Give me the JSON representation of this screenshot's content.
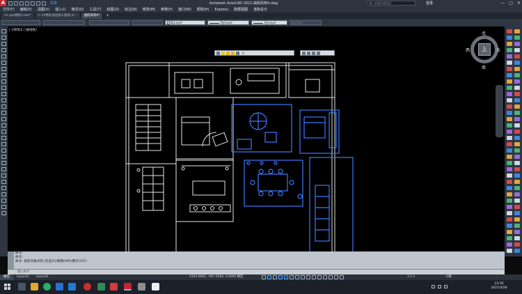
{
  "app": {
    "title": "Autodesk AutoCAD 2022    曲院风荷4.dwg",
    "search_placeholder": "键入关键字或短语",
    "user": "登录",
    "share_label": "共享",
    "window_controls": [
      "—",
      "□",
      "✕"
    ]
  },
  "menu": [
    "文件(F)",
    "编辑(E)",
    "视图(V)",
    "插入(I)",
    "格式(O)",
    "工具(T)",
    "绘图(D)",
    "标注(N)",
    "修改(M)",
    "参数(P)",
    "窗口(W)",
    "帮助(H)",
    "Express",
    "数据视图",
    "渲染设计"
  ],
  "file_tabs": [
    {
      "label": "A3 gait模板V.dwt*",
      "active": false
    },
    {
      "label": "C-2#楼标准层施工图纸(3) *",
      "active": false
    },
    {
      "label": "曲院风荷4*",
      "active": true
    }
  ],
  "properties": {
    "layer": "ByLayer",
    "linetype": "ByLayer",
    "lineweight": "ByLayer",
    "color": "ByColor"
  },
  "viewport_label": "[-][俯视][二维线框]",
  "layer_toolbar_value": "0",
  "viewcube": {
    "north": "北",
    "south": "南",
    "east": "东",
    "west": "西",
    "face": "上"
  },
  "command": {
    "history": [
      "命令:",
      "命令:",
      "命令: 指定对角点或 [栏选(F)/圈围(WP)/圈交(CP)]:"
    ],
    "input_placeholder": "键入命令"
  },
  "status": {
    "tabs": [
      {
        "label": "模型",
        "active": true
      },
      {
        "label": "Layout1",
        "active": false
      },
      {
        "label": "Layout2",
        "active": false
      }
    ],
    "coords": "4103.6892, -967.6584, 0.0000  模型",
    "scale": "1:1 ▾",
    "units": "小数"
  },
  "taskbar": {
    "time": "23:30",
    "date": "2021/4/28"
  },
  "colors": {
    "selection_blue": "#3b7bff",
    "plan_white": "#e8e8e8",
    "accent": "#c4262e"
  }
}
